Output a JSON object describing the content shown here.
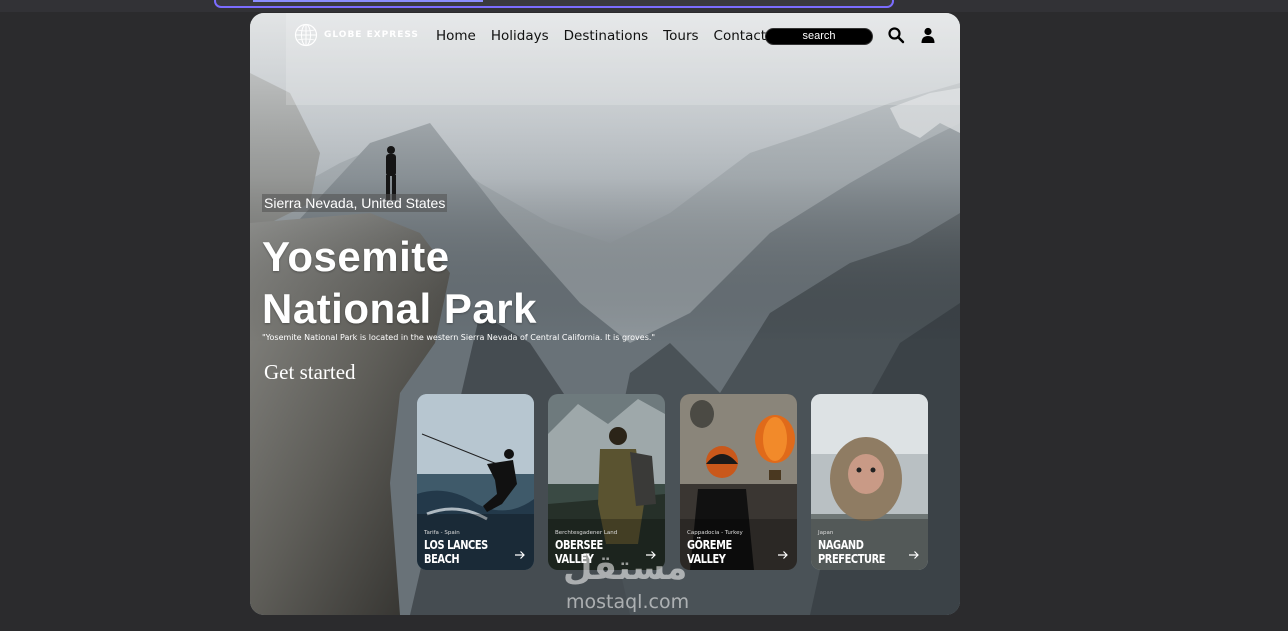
{
  "nav": {
    "logo": "GLOBE EXPRESS",
    "links": [
      "Home",
      "Holidays",
      "Destinations",
      "Tours",
      "Contact"
    ],
    "search_label": "search"
  },
  "hero": {
    "location": "Sierra Nevada, United States",
    "title_line1": "Yosemite",
    "title_line2": "National Park",
    "description": "\"Yosemite National Park is located in the western Sierra Nevada of Central California. It is groves.\"",
    "cta": "Get started"
  },
  "cards": [
    {
      "region": "Tarifa - Spain",
      "name": "Los Lances Beach"
    },
    {
      "region": "Berchtesgadener Land",
      "name": "Obersee Valley"
    },
    {
      "region": "Cappadocia - Turkey",
      "name": "Göreme Valley"
    },
    {
      "region": "Japan",
      "name": "Nagand Prefecture"
    }
  ],
  "watermark": {
    "arabic": "مستقل",
    "latin": "mostaql.com"
  },
  "colors": {
    "url_focus": "#7b6cff",
    "search_bg": "#000000",
    "text_light": "#ffffff"
  }
}
